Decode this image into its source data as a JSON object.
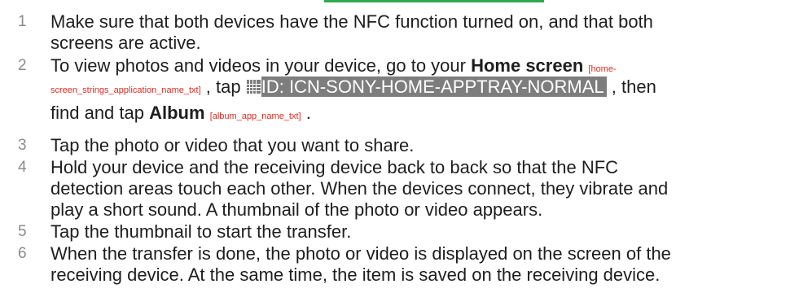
{
  "colors": {
    "top_rule": "#2fa84f",
    "step_number": "#8c8c8c",
    "body_text": "#1e1e1e",
    "string_reference": "#e02a1f",
    "icon_placeholder_bg": "#7d7d7d"
  },
  "steps": [
    {
      "number": "1",
      "line1": "Make sure that both devices have the NFC function turned on, and that both",
      "line2": "screens are active."
    },
    {
      "number": "2",
      "part1": "To view photos and videos in your device, go to your ",
      "home_screen": "Home screen",
      "home_ref_a": "[home-",
      "home_ref_b": "screen_strings_application_name_txt]",
      "after_ref": ", tap ",
      "icon_name": "apptray-grid-icon",
      "icon_id": "ID: ICN-SONY-HOME-APPTRAY-NORMAL",
      "after_icon": ", then",
      "find_tap": "find and tap ",
      "album": "Album",
      "album_ref": "[album_app_name_txt]",
      "end": "."
    },
    {
      "number": "3",
      "line1": "Tap the photo or video that you want to share."
    },
    {
      "number": "4",
      "line1": "Hold your device and the receiving device back to back so that the NFC",
      "line2": "detection areas touch each other. When the devices connect, they vibrate and",
      "line3": "play a short sound. A thumbnail of the photo or video appears."
    },
    {
      "number": "5",
      "line1": "Tap the thumbnail to start the transfer."
    },
    {
      "number": "6",
      "line1": "When the transfer is done, the photo or video is displayed on the screen of the",
      "line2": "receiving device. At the same time, the item is saved on the receiving device."
    }
  ]
}
